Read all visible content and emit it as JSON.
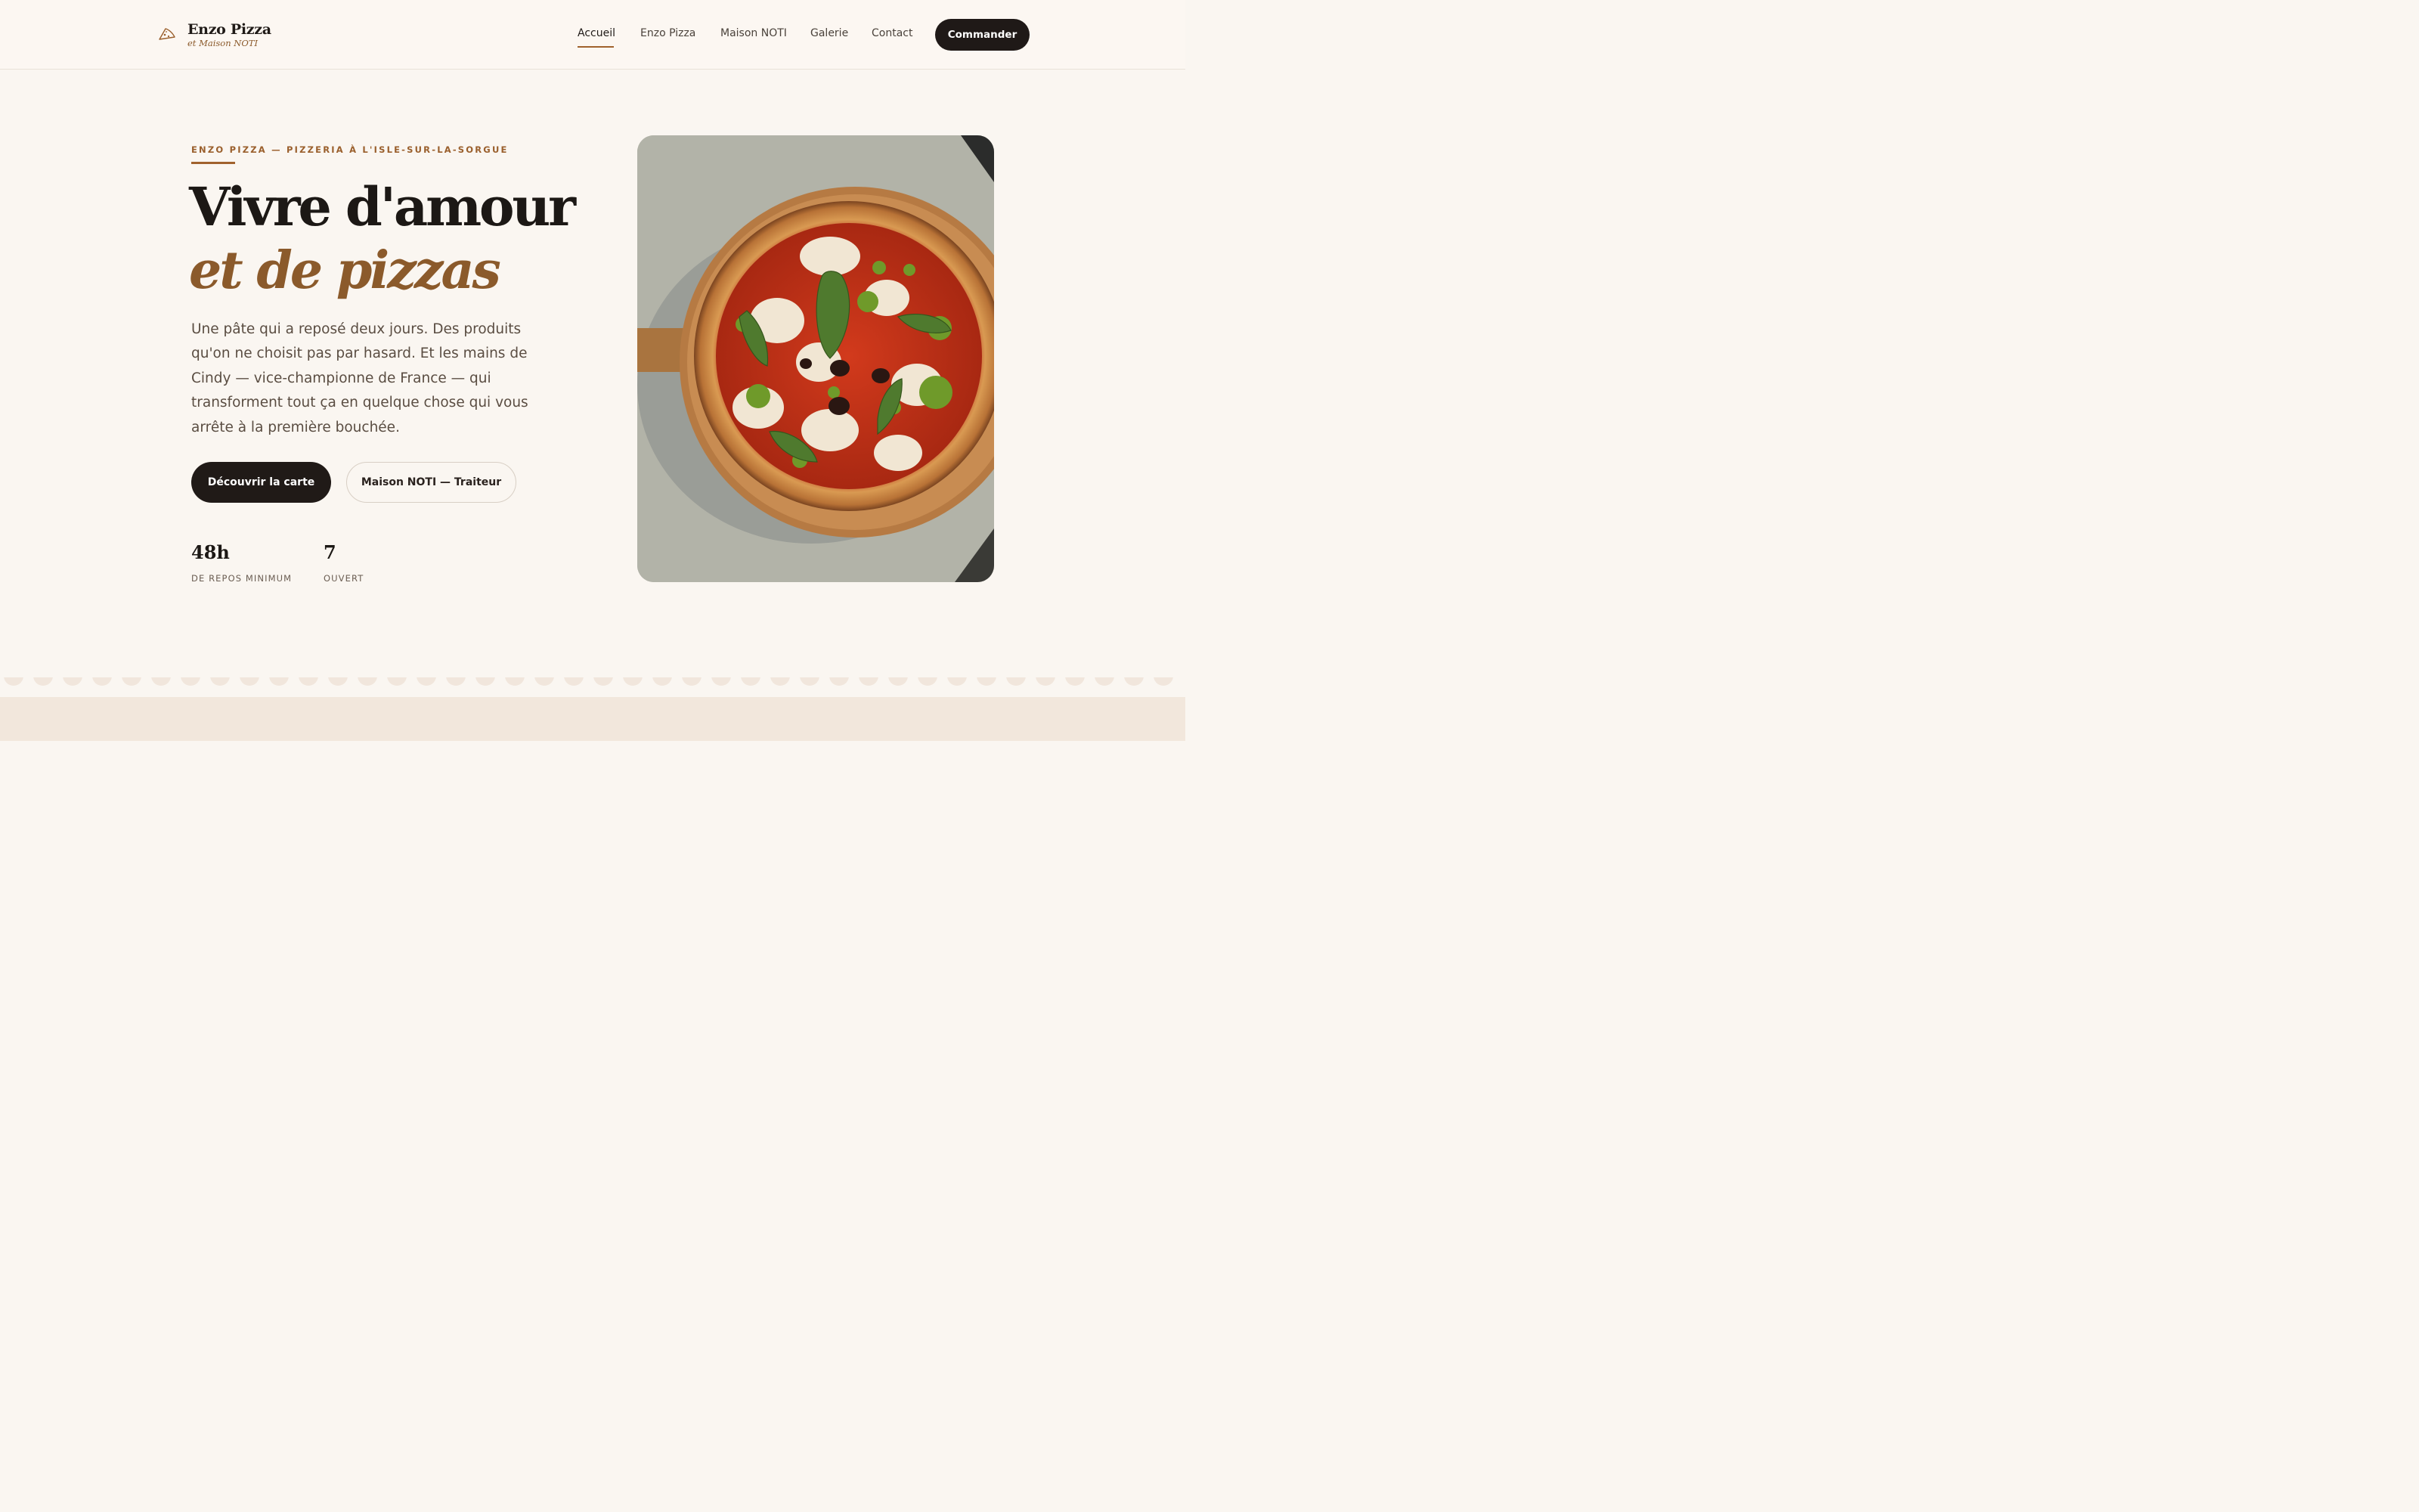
{
  "brand": {
    "name": "Enzo Pizza",
    "subtitle": "et Maison NOTI",
    "icon": "pizza-slice-icon"
  },
  "nav": {
    "items": [
      "Accueil",
      "Enzo Pizza",
      "Maison NOTI",
      "Galerie",
      "Contact"
    ],
    "active": "Accueil",
    "cta": "Commander"
  },
  "hero": {
    "eyebrow": "ENZO PIZZA — PIZZERIA À L'ISLE-SUR-LA-SORGUE",
    "title_line1": "Vivre d'amour",
    "title_line2": "et de pizzas",
    "lead": "Une pâte qui a reposé deux jours. Des produits qu'on ne choisit pas par hasard. Et les mains de Cindy — vice-championne de France — qui transforment tout ça en quelque chose qui vous arrête à la première bouchée.",
    "primary_button": "Découvrir la carte",
    "secondary_button": "Maison NOTI — Traiteur",
    "stats": [
      {
        "value": "48h",
        "label": "DE REPOS MINIMUM"
      },
      {
        "value": "7",
        "label": "OUVERT"
      }
    ],
    "image": "pizza-photo"
  },
  "colors": {
    "accent": "#8b5a2b",
    "dark": "#1f1917",
    "background": "#faf6f1",
    "band": "#f2e7dc"
  }
}
